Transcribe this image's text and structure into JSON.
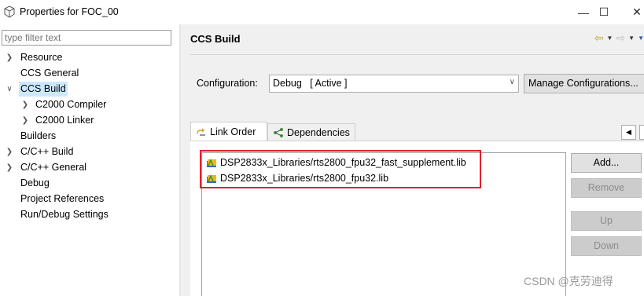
{
  "window": {
    "title": "Properties for FOC_00",
    "minimize": "—",
    "maximize": "☐",
    "close": "✕"
  },
  "filter": {
    "placeholder": "type filter text"
  },
  "tree": [
    {
      "label": "Resource",
      "expandable": true,
      "expanded": false,
      "indent": 0,
      "selected": false
    },
    {
      "label": "CCS General",
      "expandable": false,
      "indent": 0,
      "selected": false
    },
    {
      "label": "CCS Build",
      "expandable": true,
      "expanded": true,
      "indent": 0,
      "selected": true
    },
    {
      "label": "C2000 Compiler",
      "expandable": true,
      "expanded": false,
      "indent": 1,
      "selected": false
    },
    {
      "label": "C2000 Linker",
      "expandable": true,
      "expanded": false,
      "indent": 1,
      "selected": false
    },
    {
      "label": "Builders",
      "expandable": false,
      "indent": 0,
      "selected": false
    },
    {
      "label": "C/C++ Build",
      "expandable": true,
      "expanded": false,
      "indent": 0,
      "selected": false
    },
    {
      "label": "C/C++ General",
      "expandable": true,
      "expanded": false,
      "indent": 0,
      "selected": false
    },
    {
      "label": "Debug",
      "expandable": false,
      "indent": 0,
      "selected": false
    },
    {
      "label": "Project References",
      "expandable": false,
      "indent": 0,
      "selected": false
    },
    {
      "label": "Run/Debug Settings",
      "expandable": false,
      "indent": 0,
      "selected": false
    }
  ],
  "page": {
    "title": "CCS Build",
    "config_label": "Configuration:",
    "config_value": "Debug   [ Active ]",
    "manage_button": "Manage Configurations..."
  },
  "tabs": [
    {
      "label": "Link Order",
      "active": true
    },
    {
      "label": "Dependencies",
      "active": false
    }
  ],
  "libraries": [
    "DSP2833x_Libraries/rts2800_fpu32_fast_supplement.lib",
    "DSP2833x_Libraries/rts2800_fpu32.lib"
  ],
  "buttons": {
    "add": "Add...",
    "remove": "Remove",
    "up": "Up",
    "down": "Down"
  },
  "colors": {
    "highlight": "#e0202a",
    "selection": "#cce8ff",
    "back_arrow": "#c9a427"
  },
  "watermark": "CSDN @克劳迪得"
}
